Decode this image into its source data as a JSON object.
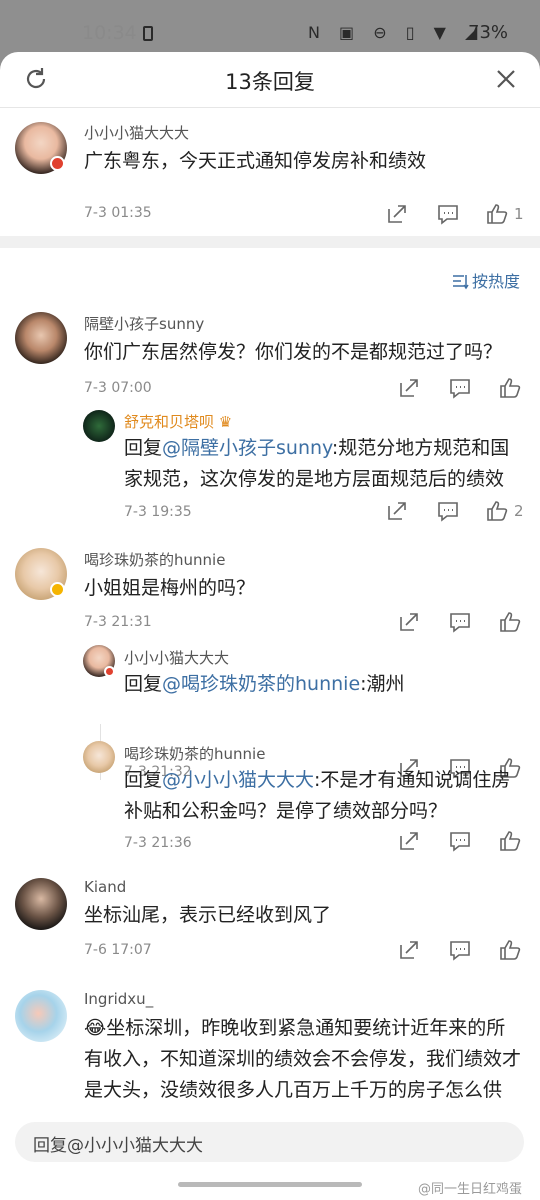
{
  "status_bar": {
    "time": "10:34",
    "battery": "73%",
    "icons": [
      "N",
      "VoLTE",
      "dnd-icon",
      "vibrate-icon",
      "wifi-icon",
      "signal-icon"
    ]
  },
  "header": {
    "title": "13条回复"
  },
  "main_comment": {
    "username": "小小小猫大大大",
    "text": "广东粤东，今天正式通知停发房补和绩效",
    "time": "7-3 01:35",
    "like_count": "1"
  },
  "sort_label": "按热度",
  "replies": [
    {
      "username": "隔壁小孩子sunny",
      "text": "你们广东居然停发？你们发的不是都规范过了吗？",
      "time": "7-3 07:00"
    },
    {
      "username": "舒克和贝塔呗",
      "prefix": "回复",
      "mention": "@隔壁小孩子sunny",
      "text": ":规范分地方规范和国家规范，这次停发的是地方层面规范后的绩效",
      "time": "7-3 19:35",
      "like_count": "2"
    },
    {
      "username": "喝珍珠奶茶的hunnie",
      "text": "小姐姐是梅州的吗？",
      "time": "7-3 21:31"
    },
    {
      "username": "小小小猫大大大",
      "prefix": "回复",
      "mention": "@喝珍珠奶茶的hunnie",
      "text": ":潮州",
      "time": "7-3 21:32"
    },
    {
      "username": "喝珍珠奶茶的hunnie",
      "prefix": "回复",
      "mention": "@小小小猫大大大",
      "text": ":不是才有通知说调住房补贴和公积金吗？是停了绩效部分吗？",
      "time": "7-3 21:36"
    },
    {
      "username": "Kiand",
      "text": "坐标汕尾，表示已经收到风了",
      "time": "7-6 17:07"
    },
    {
      "username": "Ingridxu_",
      "text": "坐标深圳，昨晚收到紧急通知要统计近年来的所有收入，不知道深圳的绩效会不会停发，我们绩效才是大头，没绩效很多人几百万上千万的房子怎么供"
    }
  ],
  "reply_input": {
    "placeholder": "回复@小小小猫大大大"
  },
  "watermark": "@同一生日红鸡蛋",
  "colors": {
    "link": "#3d6fa3",
    "vip_gold": "#e08a1e",
    "verified_badge": "#f5b400",
    "red_badge": "#e0412f"
  }
}
